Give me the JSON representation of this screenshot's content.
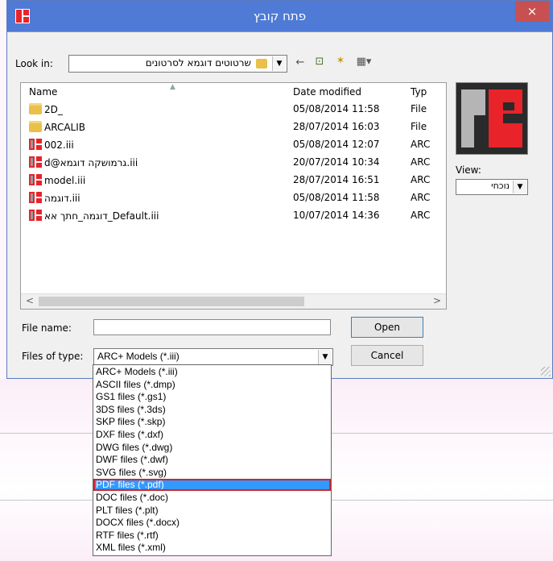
{
  "window": {
    "title": "פתח קובץ",
    "close_label": "×"
  },
  "look_in": {
    "label": "Look in:",
    "value": "שרטוטים דוגמא לסרטונים"
  },
  "columns": {
    "name": "Name",
    "date": "Date modified",
    "type": "Typ"
  },
  "files": [
    {
      "icon": "folder-icon",
      "name": "2D_",
      "date": "05/08/2014 11:58",
      "type": "File"
    },
    {
      "icon": "folder-icon",
      "name": "ARCALIB",
      "date": "28/07/2014 16:03",
      "type": "File"
    },
    {
      "icon": "arc-file-icon",
      "name": "002.iii",
      "date": "05/08/2014 12:07",
      "type": "ARC"
    },
    {
      "icon": "arc-file-icon",
      "name": "d@גרמושקה דוגמא.iii",
      "date": "20/07/2014 10:34",
      "type": "ARC"
    },
    {
      "icon": "arc-file-icon",
      "name": "model.iii",
      "date": "28/07/2014 16:51",
      "type": "ARC"
    },
    {
      "icon": "arc-file-icon",
      "name": "דוגמה.iii",
      "date": "05/08/2014 11:58",
      "type": "ARC"
    },
    {
      "icon": "arc-file-icon",
      "name": "דוגמה_חתך אא_Default.iii",
      "date": "10/07/2014 14:36",
      "type": "ARC"
    }
  ],
  "view": {
    "label": "View:",
    "value": "נוכחי"
  },
  "file_name": {
    "label": "File name:",
    "value": ""
  },
  "files_of_type": {
    "label": "Files of type:",
    "value": "ARC+ Models (*.iii)"
  },
  "buttons": {
    "open": "Open",
    "cancel": "Cancel"
  },
  "type_options": [
    "ARC+ Models (*.iii)",
    "ASCII files (*.dmp)",
    "GS1 files (*.gs1)",
    "3DS files (*.3ds)",
    "SKP files (*.skp)",
    "DXF files (*.dxf)",
    "DWG files (*.dwg)",
    "DWF files (*.dwf)",
    "SVG files (*.svg)",
    "PDF files (*.pdf)",
    "DOC files (*.doc)",
    "PLT files (*.plt)",
    "DOCX files (*.docx)",
    "RTF files (*.rtf)",
    "XML files (*.xml)"
  ],
  "selected_option": "PDF files (*.pdf)",
  "colors": {
    "titlebar": "#4f7bd6",
    "close": "#c75050",
    "selection": "#3399ff",
    "highlight_border": "#d0252d",
    "brand_red": "#e8232a"
  }
}
